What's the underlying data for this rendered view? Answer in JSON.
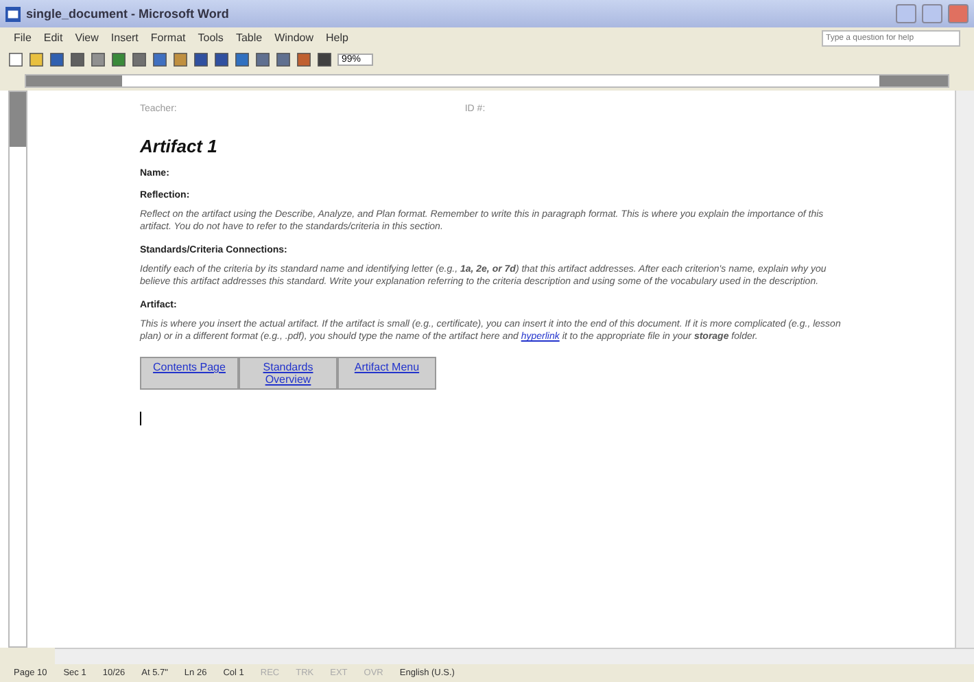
{
  "window": {
    "title": "single_document - Microsoft Word"
  },
  "menu": [
    {
      "label": "File"
    },
    {
      "label": "Edit"
    },
    {
      "label": "View"
    },
    {
      "label": "Insert"
    },
    {
      "label": "Format"
    },
    {
      "label": "Tools"
    },
    {
      "label": "Table"
    },
    {
      "label": "Window"
    },
    {
      "label": "Help"
    }
  ],
  "help_search": {
    "placeholder": "Type a question for help"
  },
  "toolbar": {
    "zoom": "99%"
  },
  "document": {
    "header": [
      {
        "label": "Teacher:"
      },
      {
        "label": "ID #:"
      }
    ],
    "title": "Artifact 1",
    "sections": [
      {
        "heading": "Name:"
      },
      {
        "heading": "Reflection:",
        "paragraph": [
          {
            "kind": "text",
            "text": "Reflect on the artifact using the Describe, Analyze, and Plan format.  Remember to write this in paragraph format.  This is where you explain the importance of this artifact.  You do not have to refer to the standards/criteria in this section."
          }
        ]
      },
      {
        "heading": "Standards/Criteria Connections:",
        "paragraph": [
          {
            "kind": "text",
            "text": "Identify each of the criteria by its standard name and identifying letter (e.g., **1a, 2e, or 7d**) that this artifact addresses.  After each criterion's name, explain why you believe this artifact addresses this standard.  Write your explanation referring to the criteria description and using some of the vocabulary used in the description."
          }
        ]
      },
      {
        "heading": "Artifact:",
        "paragraph": [
          {
            "kind": "text",
            "text": "This is where you insert the actual artifact.  If the artifact is small (e.g., certificate), you can insert it into the end of this document.  If it is more complicated (e.g., lesson plan) or in a different format (e.g., .pdf), you should type the name of the artifact here and"
          },
          {
            "kind": "link",
            "text": "hyperlink"
          },
          {
            "kind": "text",
            "text": "it to the appropriate file in your **storage** folder."
          }
        ]
      }
    ],
    "nav_links": [
      {
        "label": "Contents Page"
      },
      {
        "label": "Standards Overview"
      },
      {
        "label": "Artifact Menu"
      }
    ]
  },
  "status_bar": [
    {
      "label": "Page 10"
    },
    {
      "label": "Sec 1"
    },
    {
      "label": "10/26"
    },
    {
      "label": "At 5.7\""
    },
    {
      "label": "Ln 26"
    },
    {
      "label": "Col 1"
    },
    {
      "label": "REC",
      "disabled": true
    },
    {
      "label": "TRK",
      "disabled": true
    },
    {
      "label": "EXT",
      "disabled": true
    },
    {
      "label": "OVR",
      "disabled": true
    },
    {
      "label": "English (U.S.)",
      "disabled": false
    }
  ]
}
